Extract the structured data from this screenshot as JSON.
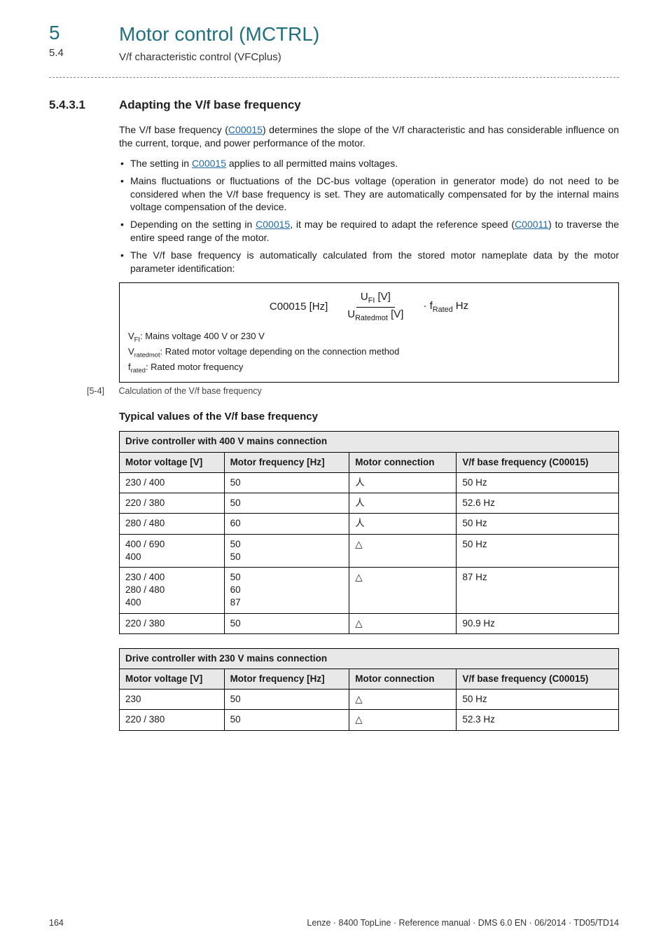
{
  "header": {
    "chapter_num": "5",
    "chapter_title": "Motor control (MCTRL)",
    "section_num": "5.4",
    "section_title": "V/f characteristic control (VFCplus)"
  },
  "section": {
    "num": "5.4.3.1",
    "title": "Adapting the V/f base frequency"
  },
  "intro": {
    "p1_a": "The V/f base frequency (",
    "p1_link": "C00015",
    "p1_b": ") determines the slope of the V/f characteristic and has considerable influence on the current, torque, and power performance of the motor."
  },
  "bullets": {
    "b1_a": "The setting in ",
    "b1_link": "C00015",
    "b1_b": " applies to all permitted mains voltages.",
    "b2": "Mains fluctuations or fluctuations of the DC-bus voltage (operation in generator mode) do not need to be considered when the V/f base frequency is set. They are automatically compensated for by the internal mains voltage compensation of the device.",
    "b3_a": "Depending on the setting in ",
    "b3_link1": "C00015",
    "b3_b": ", it may be required to adapt the reference speed (",
    "b3_link2": "C00011",
    "b3_c": ") to traverse the entire speed range of the motor.",
    "b4": "The V/f base frequency is automatically calculated from the stored motor nameplate data by the motor parameter identification:"
  },
  "formula": {
    "lhs": "C00015 [Hz]",
    "num_a": "U",
    "num_sub": "FI",
    "num_b": " [V]",
    "den_a": "U",
    "den_sub": "Ratedmot",
    "den_b": " [V]",
    "mult_a": " · f",
    "mult_sub": "Rated",
    "mult_b": " Hz",
    "note1_a": "V",
    "note1_sub": "FI",
    "note1_b": ": Mains voltage 400 V or 230 V",
    "note2_a": "V",
    "note2_sub": "ratedmot",
    "note2_b": ": Rated motor voltage depending on the connection method",
    "note3_a": "f",
    "note3_sub": "rated",
    "note3_b": ": Rated motor frequency"
  },
  "caption": {
    "num": "[5-4]",
    "text": "Calculation of the V/f base frequency"
  },
  "typical_heading": "Typical values of the V/f base frequency",
  "table1": {
    "title": "Drive controller with 400 V mains connection",
    "headers": [
      "Motor voltage [V]",
      "Motor frequency [Hz]",
      "Motor connection",
      "V/f base frequency (C00015)"
    ],
    "rows": [
      {
        "v": "230 / 400",
        "f": "50",
        "c": "star",
        "b": "50 Hz"
      },
      {
        "v": "220 / 380",
        "f": "50",
        "c": "star",
        "b": "52.6 Hz"
      },
      {
        "v": "280 / 480",
        "f": "60",
        "c": "star",
        "b": "50 Hz"
      },
      {
        "v": "400 / 690\n400",
        "f": "50\n50",
        "c": "delta",
        "b": "50 Hz"
      },
      {
        "v": "230 / 400\n280 / 480\n400",
        "f": "50\n60\n87",
        "c": "delta",
        "b": "87 Hz"
      },
      {
        "v": "220 / 380",
        "f": "50",
        "c": "delta",
        "b": "90.9 Hz"
      }
    ]
  },
  "table2": {
    "title": "Drive controller with 230 V mains connection",
    "headers": [
      "Motor voltage [V]",
      "Motor frequency [Hz]",
      "Motor connection",
      "V/f base frequency (C00015)"
    ],
    "rows": [
      {
        "v": "230",
        "f": "50",
        "c": "delta",
        "b": "50 Hz"
      },
      {
        "v": "220 / 380",
        "f": "50",
        "c": "delta",
        "b": "52.3 Hz"
      }
    ]
  },
  "symbols": {
    "star": "人",
    "delta": "△"
  },
  "footer": {
    "page": "164",
    "right": "Lenze · 8400 TopLine · Reference manual · DMS 6.0 EN · 06/2014 · TD05/TD14"
  },
  "chart_data": [
    {
      "type": "table",
      "title": "Drive controller with 400 V mains connection",
      "columns": [
        "Motor voltage [V]",
        "Motor frequency [Hz]",
        "Motor connection",
        "V/f base frequency (C00015)"
      ],
      "rows": [
        [
          "230 / 400",
          "50",
          "star",
          "50 Hz"
        ],
        [
          "220 / 380",
          "50",
          "star",
          "52.6 Hz"
        ],
        [
          "280 / 480",
          "60",
          "star",
          "50 Hz"
        ],
        [
          "400 / 690; 400",
          "50; 50",
          "delta",
          "50 Hz"
        ],
        [
          "230 / 400; 280 / 480; 400",
          "50; 60; 87",
          "delta",
          "87 Hz"
        ],
        [
          "220 / 380",
          "50",
          "delta",
          "90.9 Hz"
        ]
      ]
    },
    {
      "type": "table",
      "title": "Drive controller with 230 V mains connection",
      "columns": [
        "Motor voltage [V]",
        "Motor frequency [Hz]",
        "Motor connection",
        "V/f base frequency (C00015)"
      ],
      "rows": [
        [
          "230",
          "50",
          "delta",
          "50 Hz"
        ],
        [
          "220 / 380",
          "50",
          "delta",
          "52.3 Hz"
        ]
      ]
    }
  ]
}
